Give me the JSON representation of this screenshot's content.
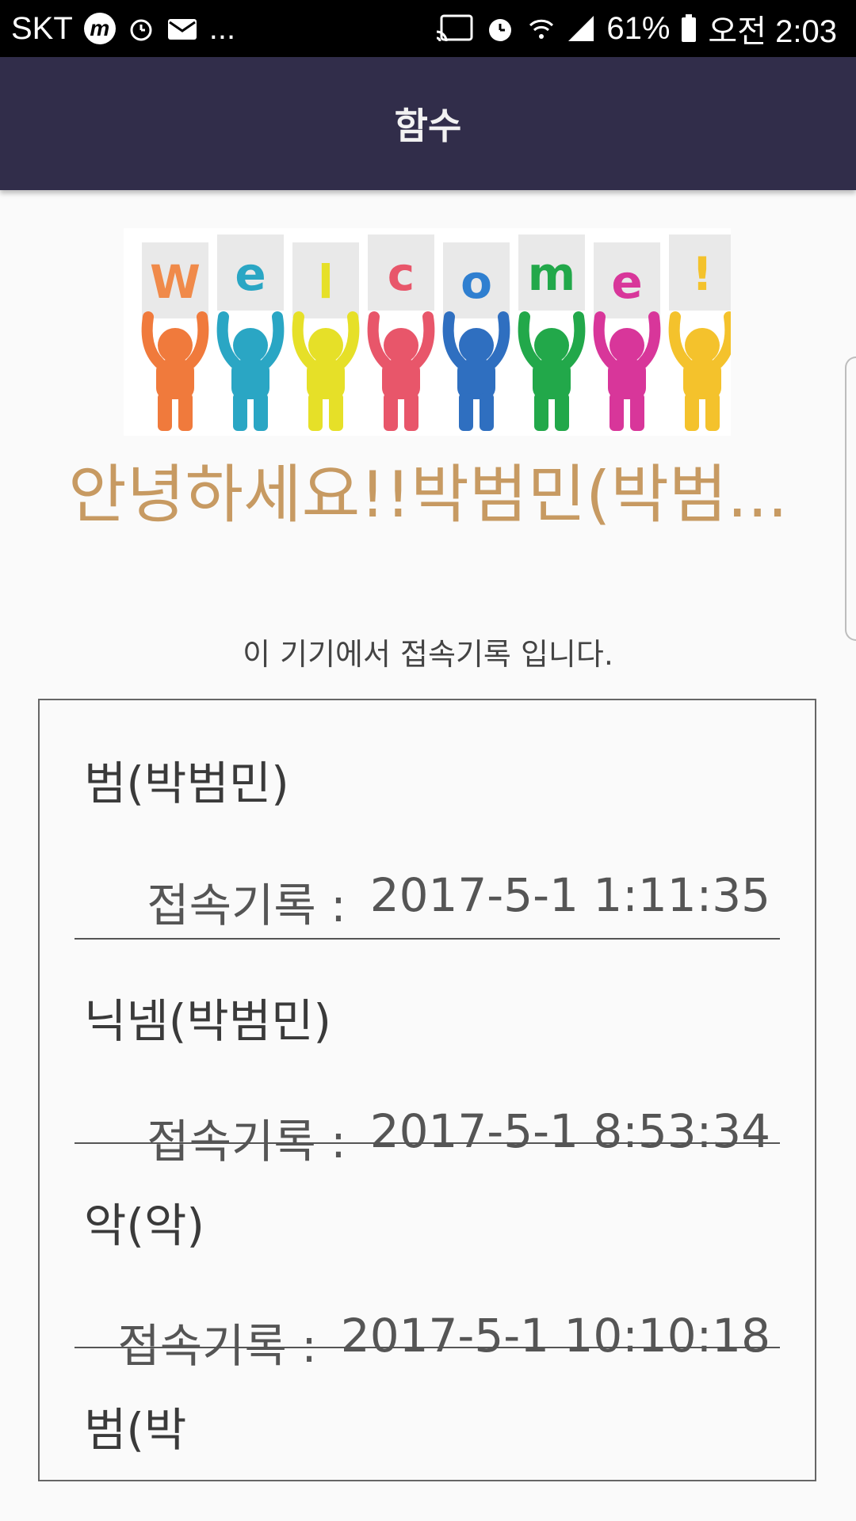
{
  "status_bar": {
    "carrier": "SKT",
    "badge_letter": "m",
    "more": "...",
    "battery": "61%",
    "time": "오전 2:03"
  },
  "app_bar": {
    "title": "함수"
  },
  "banner": {
    "letters": [
      "W",
      "e",
      "l",
      "c",
      "o",
      "m",
      "e",
      "!"
    ]
  },
  "greeting": "안녕하세요!!박범민(박범...",
  "subtitle": "이 기기에서 접속기록 입니다.",
  "records": [
    {
      "name": "범(박범민)",
      "label": "접속기록 :",
      "timestamp": "2017-5-1 1:11:35"
    },
    {
      "name": "닉넴(박범민)",
      "label": "접속기록 :",
      "timestamp": "2017-5-1 8:53:34"
    },
    {
      "name": "악(악)",
      "label": "접속기록 :",
      "timestamp": "2017-5-1 10:10:18"
    },
    {
      "name": "범(박",
      "label": "",
      "timestamp": ""
    }
  ],
  "colors": {
    "app_bar": "#312d4a",
    "greeting": "#c79a62",
    "background": "#fafafa"
  }
}
